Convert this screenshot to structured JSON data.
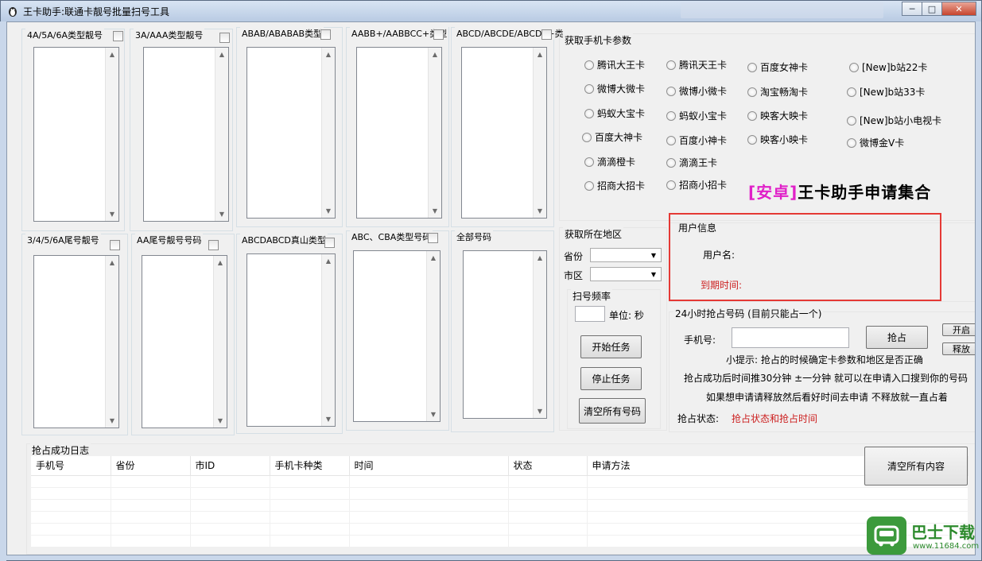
{
  "window": {
    "title": "王卡助手:联通卡靓号批量扫号工具",
    "controls": [
      "minimize-icon",
      "maximize-icon",
      "close-icon"
    ]
  },
  "number_groups": [
    {
      "label": "4A/5A/6A类型靓号"
    },
    {
      "label": "3A/AAA类型靓号"
    },
    {
      "label": "ABAB/ABABAB类型"
    },
    {
      "label": "AABB+/AABBCC+类型"
    },
    {
      "label": "ABCD/ABCDE/ABCDE+类"
    },
    {
      "label": "3/4/5/6A尾号靓号"
    },
    {
      "label": "AA尾号靓号号码"
    },
    {
      "label": "ABCDABCD真山类型"
    },
    {
      "label": "ABC、CBA类型号码"
    },
    {
      "label": "全部号码"
    }
  ],
  "card_params": {
    "title": "获取手机卡参数",
    "options": [
      "腾讯大王卡",
      "腾讯天王卡",
      "百度女神卡",
      "[New]b站22卡",
      "微博大微卡",
      "微博小微卡",
      "淘宝畅淘卡",
      "[New]b站33卡",
      "蚂蚁大宝卡",
      "蚂蚁小宝卡",
      "映客大映卡",
      "[New]b站小电视卡",
      "百度大神卡",
      "百度小神卡",
      "映客小映卡",
      "微博金V卡",
      "滴滴橙卡",
      "滴滴王卡",
      "招商大招卡",
      "招商小招卡"
    ]
  },
  "promo": {
    "prefix": "[安卓]",
    "text": "王卡助手申请集合"
  },
  "region": {
    "title": "获取所在地区",
    "province_label": "省份",
    "city_label": "市区",
    "freq_title": "扫号频率",
    "unit_label": "单位: 秒",
    "start_button": "开始任务",
    "stop_button": "停止任务",
    "clear_button": "清空所有号码"
  },
  "user_info": {
    "title": "用户信息",
    "username_label": "用户名:",
    "expire_label": "到期时间:"
  },
  "grab": {
    "title": "24小时抢占号码 (目前只能占一个)",
    "phone_label": "手机号:",
    "grab_button": "抢占",
    "open_button": "开启",
    "release_button": "释放",
    "tip1": "小提示: 抢占的时候确定卡参数和地区是否正确",
    "tip2": "抢占成功后时间推30分钟 ±一分钟 就可以在申请入口搜到你的号码",
    "tip3": "如果想申请请释放然后看好时间去申请 不释放就一直占着",
    "status_label": "抢占状态:",
    "status_value": "抢占状态和抢占时间"
  },
  "log": {
    "title": "抢占成功日志",
    "columns": [
      "手机号",
      "省份",
      "市ID",
      "手机卡种类",
      "时间",
      "状态",
      "申请方法"
    ],
    "clear_button": "清空所有内容"
  },
  "watermark": {
    "name": "巴士下载",
    "url": "www.11684.com"
  },
  "colors": {
    "red": "#cc1f1f",
    "magenta": "#e020c8",
    "highlight_box": "#e53935"
  }
}
